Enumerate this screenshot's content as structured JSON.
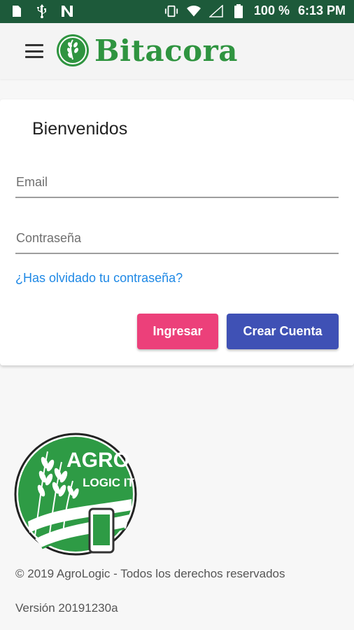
{
  "status_bar": {
    "battery": "100 %",
    "time": "6:13 PM",
    "left_icons": [
      "sim-icon",
      "usb-icon",
      "n-icon"
    ],
    "right_icons": [
      "vibrate-icon",
      "wifi-icon",
      "signal-icon",
      "battery-icon"
    ]
  },
  "app_bar": {
    "title": "Bitacora",
    "menu_icon": "menu-icon",
    "logo_icon": "wheat-leaf-icon",
    "brand_color": "#2f9440"
  },
  "login": {
    "heading": "Bienvenidos",
    "email_placeholder": "Email",
    "password_placeholder": "Contraseña",
    "forgot_link": "¿Has olvidado tu contraseña?",
    "login_button": "Ingresar",
    "create_button": "Crear Cuenta",
    "colors": {
      "login": "#ec407a",
      "create": "#3f51b5",
      "link": "#1e88e5"
    }
  },
  "footer": {
    "logo_text_top": "AGRO",
    "logo_text_bottom": "LOGIC IT",
    "copyright": "© 2019 AgroLogic - Todos los derechos reservados",
    "version": "Versión 20191230a"
  }
}
